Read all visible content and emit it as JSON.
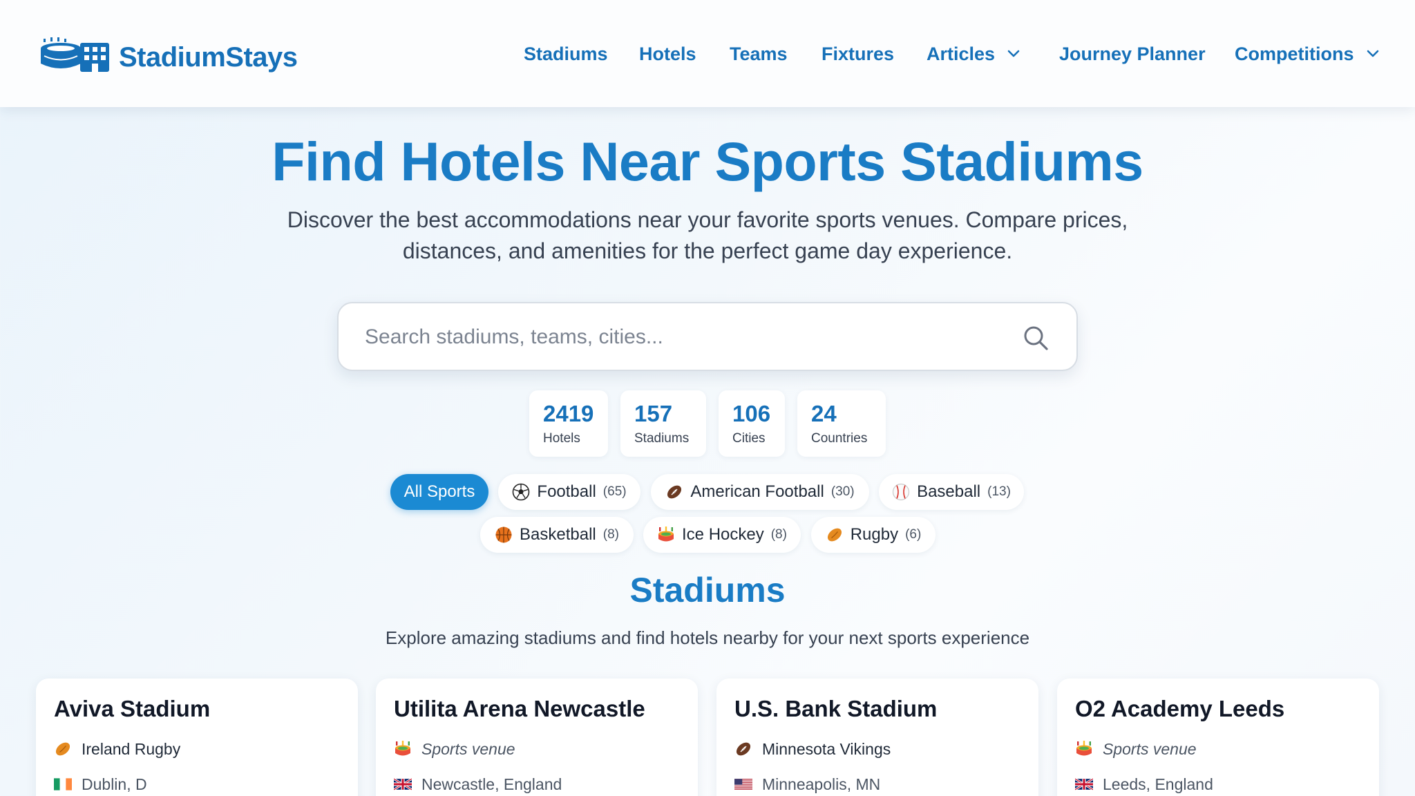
{
  "brand": {
    "name": "StadiumStays",
    "color": "#1670b8"
  },
  "nav": {
    "items": [
      {
        "label": "Stadiums",
        "has_dropdown": false
      },
      {
        "label": "Hotels",
        "has_dropdown": false
      },
      {
        "label": "Teams",
        "has_dropdown": false
      },
      {
        "label": "Fixtures",
        "has_dropdown": false
      },
      {
        "label": "Articles",
        "has_dropdown": true
      },
      {
        "label": "Journey Planner",
        "has_dropdown": false
      },
      {
        "label": "Competitions",
        "has_dropdown": true
      }
    ]
  },
  "hero": {
    "title": "Find Hotels Near Sports Stadiums",
    "subtitle": "Discover the best accommodations near your favorite sports venues. Compare prices, distances, and amenities for the perfect game day experience."
  },
  "search": {
    "placeholder": "Search stadiums, teams, cities...",
    "value": "",
    "icon": "search-icon"
  },
  "stats": [
    {
      "value": "2419",
      "label": "Hotels"
    },
    {
      "value": "157",
      "label": "Stadiums"
    },
    {
      "value": "106",
      "label": "Cities"
    },
    {
      "value": "24",
      "label": "Countries"
    }
  ],
  "sports": [
    {
      "label": "All Sports",
      "count": "",
      "icon": "",
      "active": true
    },
    {
      "label": "Football",
      "count": "(65)",
      "icon": "soccer-ball-icon",
      "active": false
    },
    {
      "label": "American Football",
      "count": "(30)",
      "icon": "american-football-icon",
      "active": false
    },
    {
      "label": "Baseball",
      "count": "(13)",
      "icon": "baseball-icon",
      "active": false
    },
    {
      "label": "Basketball",
      "count": "(8)",
      "icon": "basketball-icon",
      "active": false
    },
    {
      "label": "Ice Hockey",
      "count": "(8)",
      "icon": "stadium-icon",
      "active": false
    },
    {
      "label": "Rugby",
      "count": "(6)",
      "icon": "rugby-ball-icon",
      "active": false
    }
  ],
  "section": {
    "title": "Stadiums",
    "subtitle": "Explore amazing stadiums and find hotels nearby for your next sports experience"
  },
  "stadiums": [
    {
      "name": "Aviva Stadium",
      "team": "Ireland Rugby",
      "team_icon": "rugby-ball-icon",
      "location": "Dublin, D",
      "flag": "ireland-flag-icon"
    },
    {
      "name": "Utilita Arena Newcastle",
      "team": "Sports venue",
      "team_icon": "stadium-icon",
      "location": "Newcastle, England",
      "flag": "uk-flag-icon"
    },
    {
      "name": "U.S. Bank Stadium",
      "team": "Minnesota Vikings",
      "team_icon": "american-football-icon",
      "location": "Minneapolis, MN",
      "flag": "us-flag-icon"
    },
    {
      "name": "O2 Academy Leeds",
      "team": "Sports venue",
      "team_icon": "stadium-icon",
      "location": "Leeds, England",
      "flag": "uk-flag-icon"
    }
  ],
  "colors": {
    "primary": "#1a7cc5",
    "chip_active": "#1b8ad3",
    "text": "#1f2937"
  }
}
